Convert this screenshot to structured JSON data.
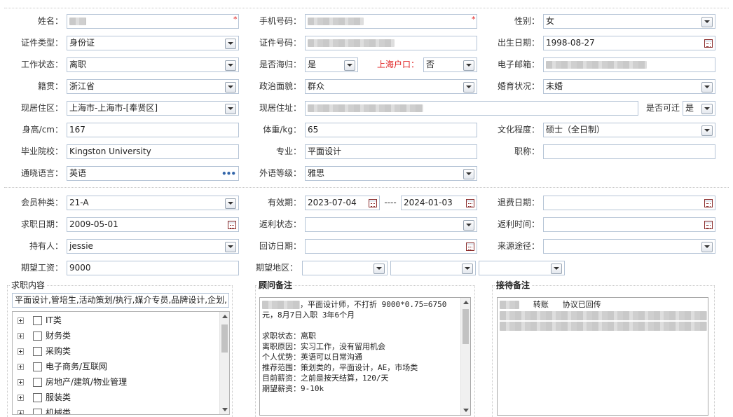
{
  "profile": {
    "name": {
      "label": "姓名：",
      "required_mark": "*"
    },
    "phone": {
      "label": "手机号码：",
      "required_mark": "*"
    },
    "gender": {
      "label": "性别：",
      "value": "女"
    },
    "id_type": {
      "label": "证件类型：",
      "value": "身份证"
    },
    "id_number": {
      "label": "证件号码："
    },
    "birth_date": {
      "label": "出生日期：",
      "value": "1998-08-27"
    },
    "work_status": {
      "label": "工作状态：",
      "value": "离职"
    },
    "returnee": {
      "label": "是否海归：",
      "value": "是"
    },
    "shanghai_hukou": {
      "label": "上海户口：",
      "value": "否"
    },
    "email": {
      "label": "电子邮箱："
    },
    "native_place": {
      "label": "籍贯：",
      "value": "浙江省"
    },
    "political_status": {
      "label": "政治面貌：",
      "value": "群众"
    },
    "marital_status": {
      "label": "婚育状况：",
      "value": "未婚"
    },
    "residence_area": {
      "label": "现居住区：",
      "value": "上海市-上海市-[奉贤区]"
    },
    "residence_address": {
      "label": "现居住址："
    },
    "relocatable": {
      "label": "是否可迁",
      "value": "是"
    },
    "height": {
      "label": "身高/cm：",
      "value": "167"
    },
    "weight": {
      "label": "体重/kg：",
      "value": "65"
    },
    "education": {
      "label": "文化程度：",
      "value": "硕士（全日制）"
    },
    "school": {
      "label": "毕业院校：",
      "value": "Kingston University"
    },
    "major": {
      "label": "专业：",
      "value": "平面设计"
    },
    "title": {
      "label": "职称：",
      "value": ""
    },
    "language": {
      "label": "通晓语言：",
      "value": "英语"
    },
    "foreign_level": {
      "label": "外语等级：",
      "value": "雅思"
    }
  },
  "membership": {
    "member_type": {
      "label": "会员种类：",
      "value": "21-A"
    },
    "validity": {
      "label": "有效期：",
      "start": "2023-07-04",
      "separator": "----",
      "end": "2024-01-03"
    },
    "refund_date": {
      "label": "退费日期：",
      "value": ""
    },
    "job_date": {
      "label": "求职日期：",
      "value": "2009-05-01"
    },
    "rebate_status": {
      "label": "返利状态：",
      "value": ""
    },
    "rebate_time": {
      "label": "返利时间：",
      "value": ""
    },
    "holder": {
      "label": "持有人：",
      "value": "jessie"
    },
    "visit_date": {
      "label": "回访日期：",
      "value": ""
    },
    "source": {
      "label": "来源途径：",
      "value": ""
    },
    "expected_salary": {
      "label": "期望工资：",
      "value": "9000"
    },
    "expected_region": {
      "label": "期望地区：",
      "v1": "",
      "v2": "",
      "v3": ""
    }
  },
  "job_content": {
    "title": "求职内容",
    "text": "平面设计,管培生,活动策划/执行,媒介专员,品牌设计,企划,",
    "tree": [
      "IT类",
      "财务类",
      "采购类",
      "电子商务/互联网",
      "房地产/建筑/物业管理",
      "服装类",
      "机械类"
    ]
  },
  "consultant_notes": {
    "title": "顾问备注",
    "line1": "，平面设计师，不打折 9000*0.75=6750",
    "body": "元，8月7日入职 3年6个月\n\n求职状态：离职\n离职原因：实习工作，没有留用机会\n个人优势：英语可以日常沟通\n推荐范围：策划类的，平面设计，AE，市场类\n目前薪资：之前是按天结算，120/天\n期望薪资：9-10k"
  },
  "reception_notes": {
    "title": "接待备注",
    "line1": "转账   协议已回传"
  }
}
